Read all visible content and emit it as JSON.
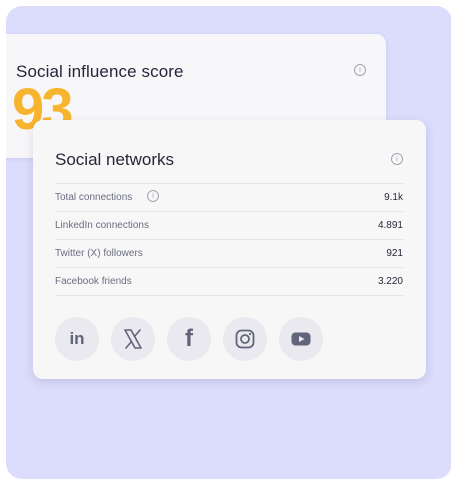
{
  "influence": {
    "title": "Social influence score",
    "score": "93",
    "info_icon": "info-icon"
  },
  "networks": {
    "title": "Social networks",
    "info_icon": "info-icon",
    "stats": [
      {
        "label": "Total connections",
        "value": "9.1k"
      },
      {
        "label": "LinkedIn connections",
        "value": "4.891"
      },
      {
        "label": "Twitter (X) followers",
        "value": "921"
      },
      {
        "label": "Facebook friends",
        "value": "3.220"
      }
    ],
    "social_icons": [
      {
        "name": "linkedin-icon",
        "glyph": "in"
      },
      {
        "name": "x-icon"
      },
      {
        "name": "facebook-icon",
        "glyph": "f"
      },
      {
        "name": "instagram-icon"
      },
      {
        "name": "youtube-icon"
      }
    ]
  },
  "colors": {
    "background": "#dcdcfd",
    "accent_score": "#f7b52f",
    "card": "#f7f7f8",
    "icon_circle": "#e9e9ef"
  }
}
